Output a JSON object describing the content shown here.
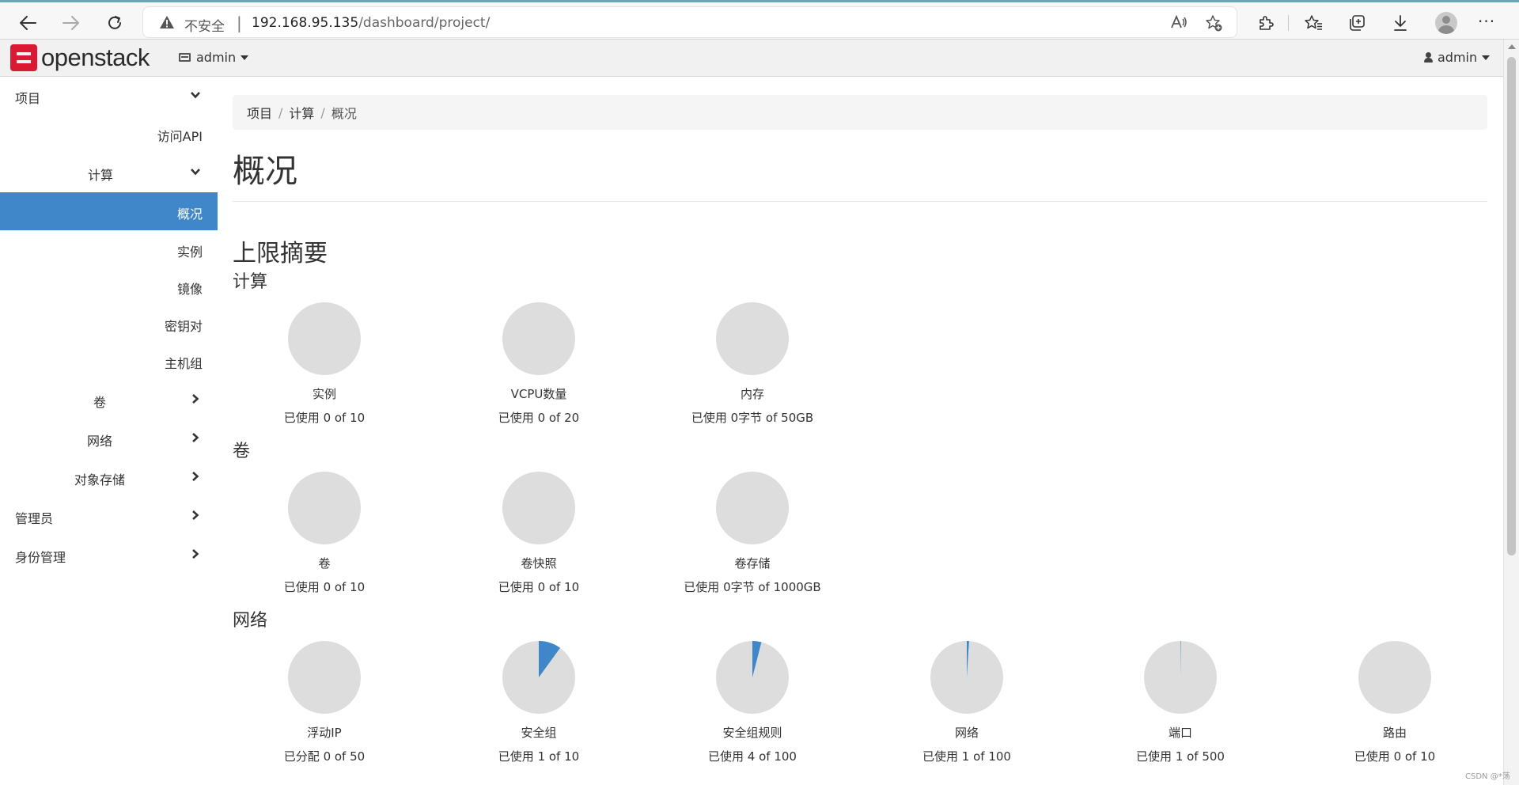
{
  "browser": {
    "security_label": "不安全",
    "url_host": "192.168.95.135",
    "url_path": "/dashboard/project/"
  },
  "header": {
    "brand": "openstack",
    "project_switcher": "admin",
    "user_menu": "admin"
  },
  "sidebar": {
    "items": [
      {
        "label": "项目"
      },
      {
        "label": "访问API"
      },
      {
        "label": "计算"
      },
      {
        "label": "概况"
      },
      {
        "label": "实例"
      },
      {
        "label": "镜像"
      },
      {
        "label": "密钥对"
      },
      {
        "label": "主机组"
      },
      {
        "label": "卷"
      },
      {
        "label": "网络"
      },
      {
        "label": "对象存储"
      },
      {
        "label": "管理员"
      },
      {
        "label": "身份管理"
      }
    ]
  },
  "breadcrumb": [
    "项目",
    "计算",
    "概况"
  ],
  "page_title": "概况",
  "limits_title": "上限摘要",
  "sections": {
    "compute": {
      "title": "计算",
      "quotas": [
        {
          "name": "实例",
          "usage": "已使用 0 of 10",
          "used_fraction": 0
        },
        {
          "name": "VCPU数量",
          "usage": "已使用 0 of 20",
          "used_fraction": 0
        },
        {
          "name": "内存",
          "usage": "已使用 0字节 of 50GB",
          "used_fraction": 0
        }
      ]
    },
    "volume": {
      "title": "卷",
      "quotas": [
        {
          "name": "卷",
          "usage": "已使用 0 of 10",
          "used_fraction": 0
        },
        {
          "name": "卷快照",
          "usage": "已使用 0 of 10",
          "used_fraction": 0
        },
        {
          "name": "卷存储",
          "usage": "已使用 0字节 of 1000GB",
          "used_fraction": 0
        }
      ]
    },
    "network": {
      "title": "网络",
      "quotas": [
        {
          "name": "浮动IP",
          "usage": "已分配 0 of 50",
          "used_fraction": 0
        },
        {
          "name": "安全组",
          "usage": "已使用 1 of 10",
          "used_fraction": 0.1
        },
        {
          "name": "安全组规则",
          "usage": "已使用 4 of 100",
          "used_fraction": 0.04
        },
        {
          "name": "网络",
          "usage": "已使用 1 of 100",
          "used_fraction": 0.01
        },
        {
          "name": "端口",
          "usage": "已使用 1 of 500",
          "used_fraction": 0.002
        },
        {
          "name": "路由",
          "usage": "已使用 0 of 10",
          "used_fraction": 0
        }
      ]
    }
  },
  "colors": {
    "pie_empty": "#dddddd",
    "pie_used": "#3f87c8",
    "nav_active": "#3f87c8",
    "brand_red": "#da1a32"
  },
  "watermark": "CSDN @*荡"
}
